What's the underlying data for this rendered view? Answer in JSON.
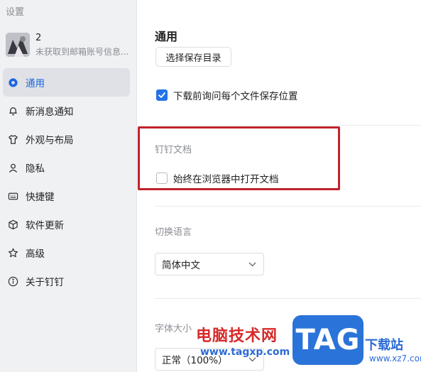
{
  "window": {
    "title": "设置"
  },
  "user": {
    "name": "2",
    "subtitle": "未获取到邮箱账号信息..."
  },
  "sidebar": {
    "items": [
      {
        "label": "通用",
        "icon": "gear-icon",
        "active": true
      },
      {
        "label": "新消息通知",
        "icon": "bell-icon",
        "active": false
      },
      {
        "label": "外观与布局",
        "icon": "shirt-icon",
        "active": false
      },
      {
        "label": "隐私",
        "icon": "person-icon",
        "active": false
      },
      {
        "label": "快捷键",
        "icon": "keyboard-icon",
        "active": false
      },
      {
        "label": "软件更新",
        "icon": "package-icon",
        "active": false
      },
      {
        "label": "高级",
        "icon": "star-icon",
        "active": false
      },
      {
        "label": "关于钉钉",
        "icon": "info-icon",
        "active": false
      }
    ]
  },
  "general": {
    "title": "通用",
    "choose_dir_button": "选择保存目录",
    "ask_location_checkbox": {
      "label": "下载前询问每个文件保存位置",
      "checked": true
    }
  },
  "dingtalk_docs": {
    "title": "钉钉文档",
    "open_in_browser_checkbox": {
      "label": "始终在浏览器中打开文档",
      "checked": false
    }
  },
  "language": {
    "title": "切换语言",
    "selected": "简体中文"
  },
  "font_size": {
    "title": "字体大小",
    "selected": "正常（100%）"
  },
  "watermark": {
    "text": "电脑技术网",
    "url": "www.tagxp.com",
    "logo": "TAG",
    "site": "下载站",
    "site_url": "www.xz7.com"
  },
  "colors": {
    "accent": "#2473e8",
    "highlight": "#c0232b"
  }
}
